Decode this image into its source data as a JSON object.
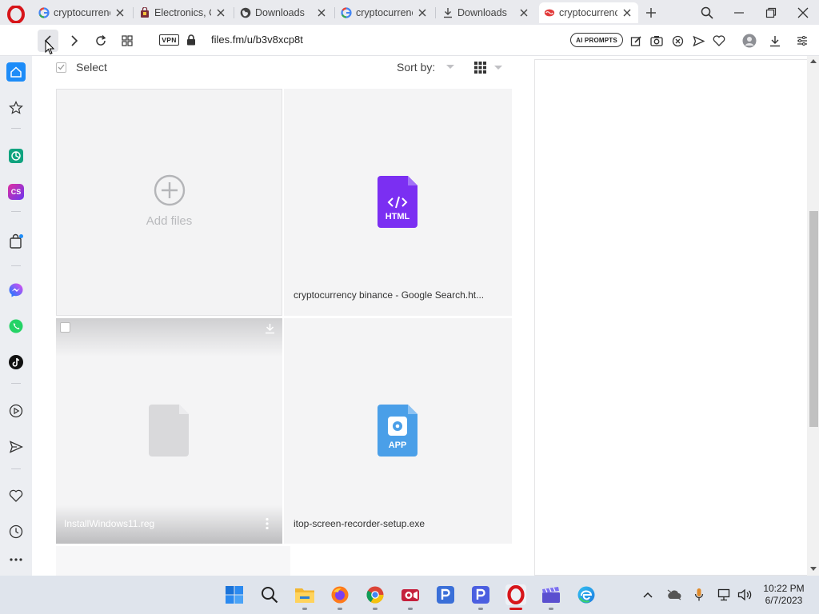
{
  "browser": {
    "tabs": [
      {
        "title": "cryptocurrenc",
        "favicon": "google-icon"
      },
      {
        "title": "Electronics, C",
        "favicon": "shopping-icon"
      },
      {
        "title": "Downloads",
        "favicon": "globe-icon"
      },
      {
        "title": "cryptocurrenc",
        "favicon": "google-icon"
      },
      {
        "title": "Downloads",
        "favicon": "download-icon"
      },
      {
        "title": "cryptocurrenc",
        "favicon": "filesfm-icon",
        "active": true
      }
    ],
    "address": {
      "vpn_label": "VPN",
      "url": "files.fm/u/b3v8xcp8t"
    },
    "ai_prompts_label": "AI PROMPTS"
  },
  "sidebar": {
    "items": [
      "home-icon",
      "star-icon",
      "chatgpt-icon",
      "cs-icon",
      "shopping-bag-icon",
      "messenger-icon",
      "whatsapp-icon",
      "tiktok-icon",
      "player-icon",
      "send-icon",
      "heart-icon",
      "history-icon",
      "more-icon"
    ],
    "cs_label": "CS"
  },
  "page": {
    "select_label": "Select",
    "sort_label": "Sort by:",
    "add_files_label": "Add files",
    "files": [
      {
        "name": "cryptocurrency binance - Google Search.ht...",
        "type_label": "HTML",
        "color": "#7b2ff2"
      },
      {
        "name": "InstallWindows11.reg",
        "type_label": "",
        "color": "#d9d9db"
      },
      {
        "name": "itop-screen-recorder-setup.exe",
        "type_label": "APP",
        "color": "#4a9fe8"
      }
    ]
  },
  "taskbar": {
    "apps": [
      "windows-start-icon",
      "search-icon",
      "file-explorer-icon",
      "firefox-icon",
      "chrome-icon",
      "screen-recorder-icon",
      "p-app-icon",
      "p-app-2-icon",
      "opera-icon",
      "clapper-icon",
      "edge-icon"
    ],
    "time": "10:22 PM",
    "date": "6/7/2023"
  },
  "colors": {
    "opera_red": "#d7151a",
    "sidebar_home_blue": "#1d8cf8",
    "html_purple": "#7b2ff2",
    "app_blue": "#4a9fe8"
  }
}
